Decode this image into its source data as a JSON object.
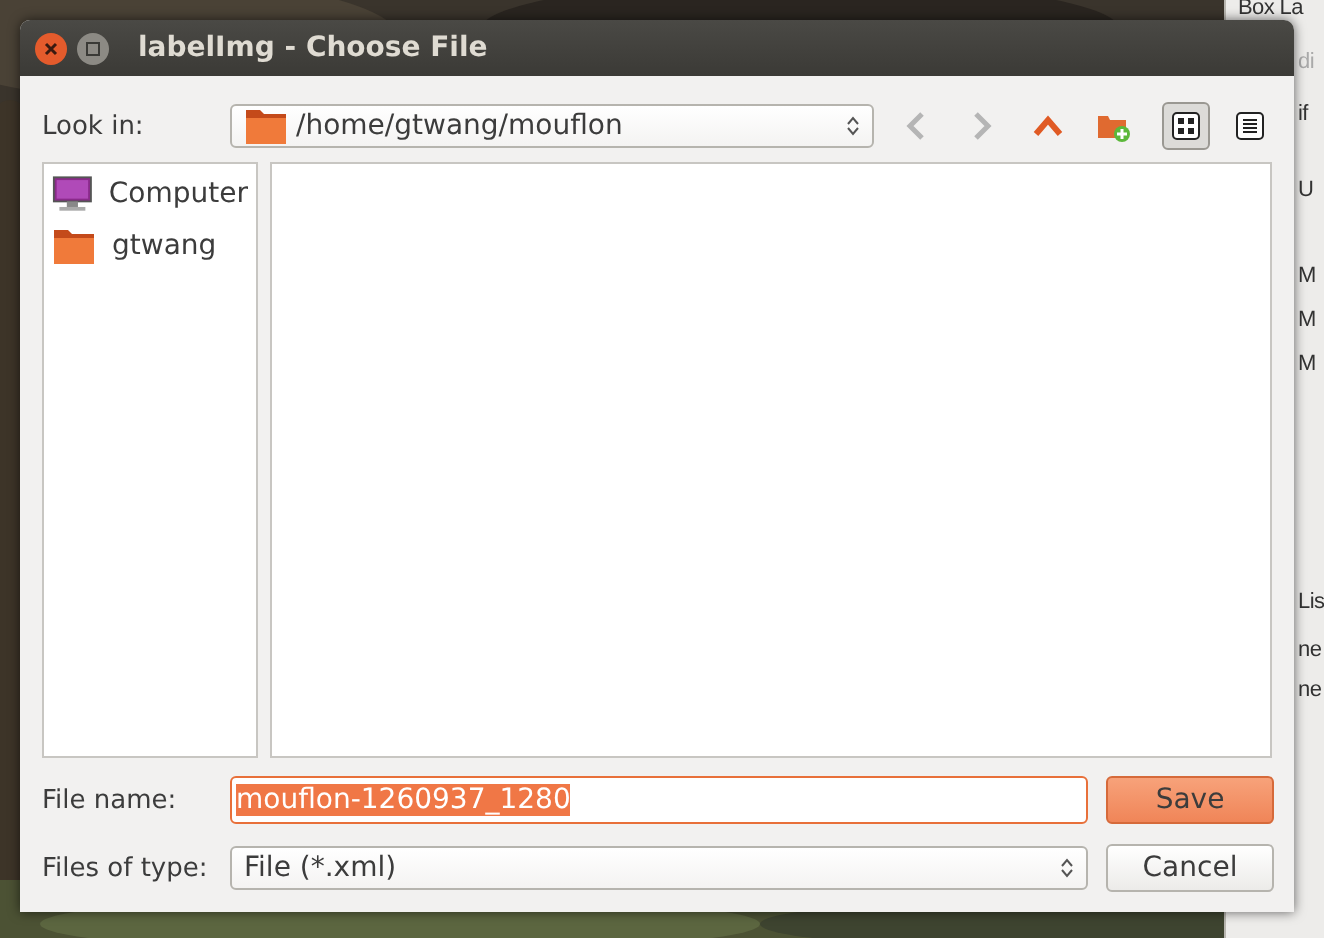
{
  "background_window": {
    "texts": [
      "Box La",
      "di",
      "if",
      "U",
      "M",
      "M",
      "M",
      "Lis",
      "ne",
      "ne"
    ]
  },
  "dialog": {
    "title": "labelImg - Choose File",
    "look_in": {
      "label": "Look in:",
      "value": "/home/gtwang/mouflon"
    },
    "nav_buttons": [
      {
        "kind": "back",
        "disabled": true
      },
      {
        "kind": "forward",
        "disabled": true
      },
      {
        "kind": "up",
        "disabled": false
      },
      {
        "kind": "new-folder",
        "disabled": false
      }
    ],
    "view_modes": [
      {
        "kind": "icons",
        "selected": true
      },
      {
        "kind": "details",
        "selected": false
      }
    ],
    "places": [
      {
        "kind": "computer",
        "label": "Computer"
      },
      {
        "kind": "folder",
        "label": "gtwang"
      }
    ],
    "file_name": {
      "label": "File name:",
      "value": "mouflon-1260937_1280",
      "value_selected": true
    },
    "files_of_type": {
      "label": "Files of type:",
      "value": "File (*.xml)"
    },
    "buttons": [
      {
        "label": "Save",
        "default": true
      },
      {
        "label": "Cancel",
        "default": false
      }
    ]
  }
}
